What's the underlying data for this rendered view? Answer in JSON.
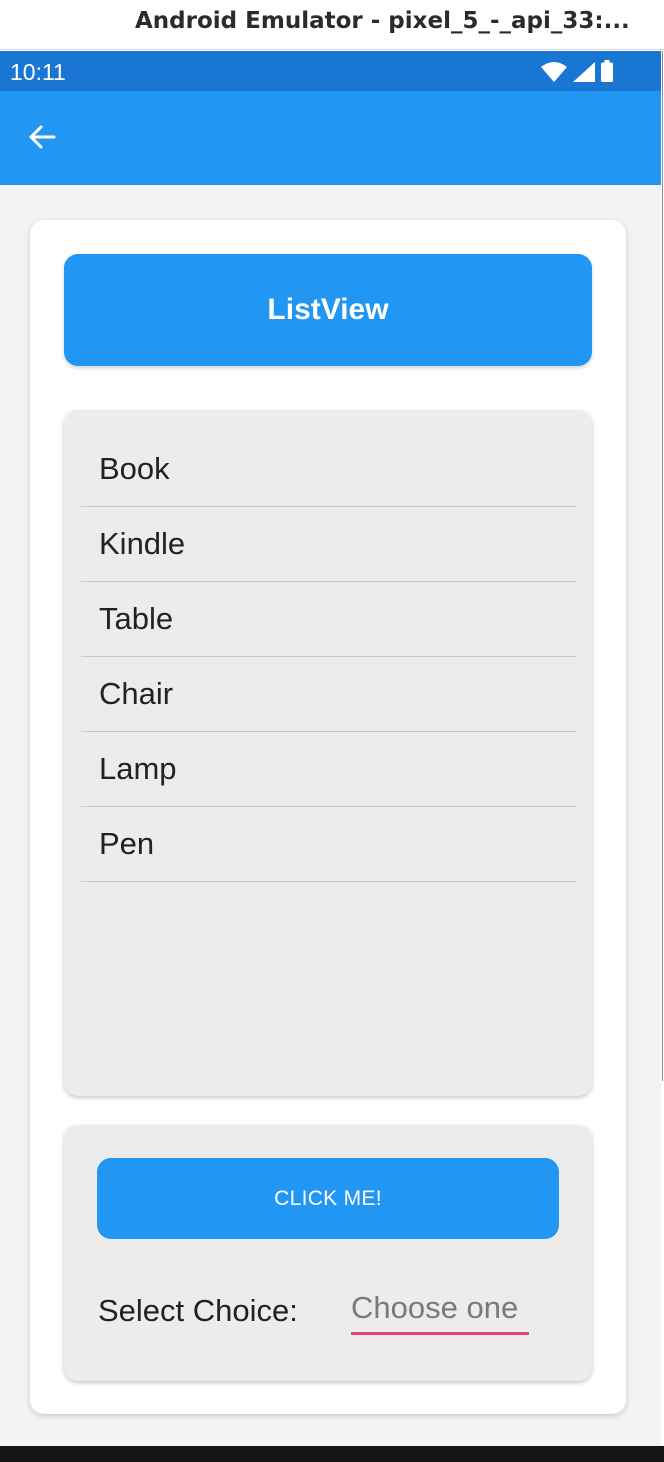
{
  "window": {
    "title": "Android Emulator - pixel_5_-_api_33:..."
  },
  "status_bar": {
    "time": "10:11",
    "icons": [
      "wifi-icon",
      "signal-icon",
      "battery-icon"
    ]
  },
  "app_bar": {
    "back_icon": "back-arrow-icon"
  },
  "header": {
    "label": "ListView"
  },
  "list": {
    "items": [
      "Book",
      "Kindle",
      "Table",
      "Chair",
      "Lamp",
      "Pen"
    ]
  },
  "actions": {
    "click_label": "CLICK ME!",
    "select_label": "Select Choice:",
    "picker_placeholder": "Choose one"
  },
  "colors": {
    "status_bar": "#1976d2",
    "primary": "#2196f3",
    "accent_underline": "#e8407a"
  }
}
